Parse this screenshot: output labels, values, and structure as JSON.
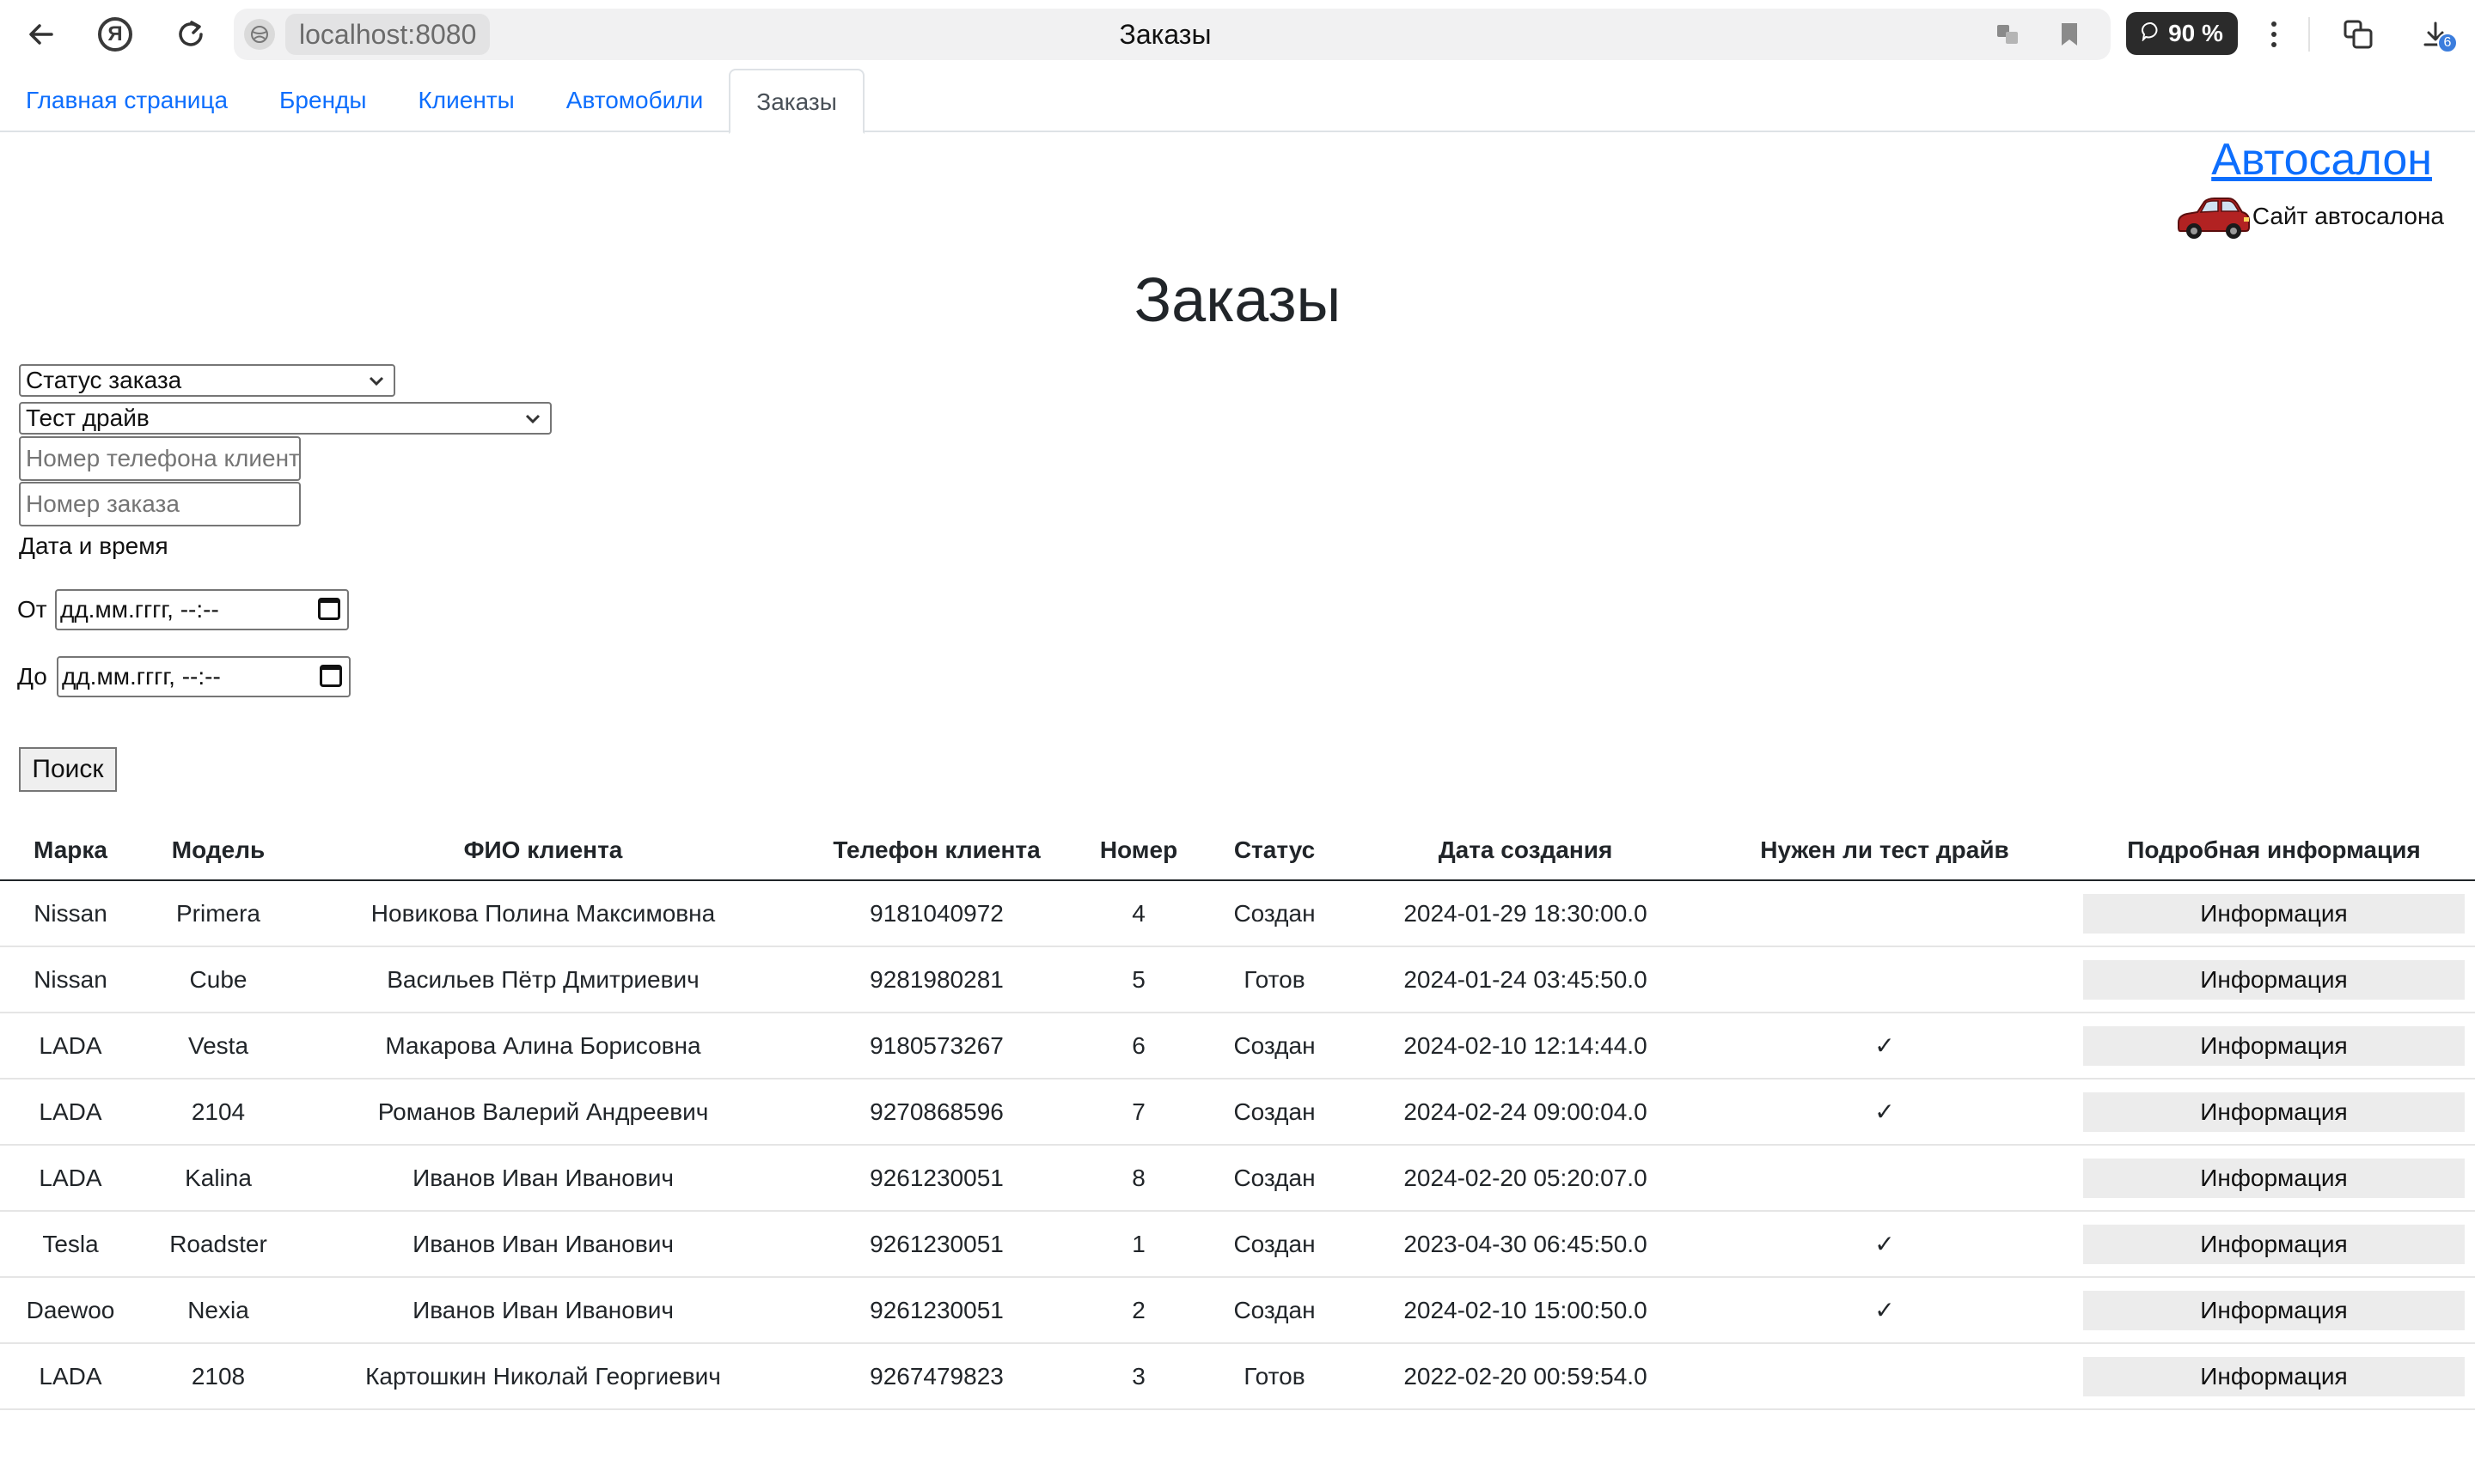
{
  "browser": {
    "url": "localhost:8080",
    "tab_title": "Заказы",
    "zoom": "90 %",
    "downloads_count": "6",
    "icons": [
      "back-arrow-icon",
      "yandex-logo-icon",
      "reload-icon",
      "site-info-icon",
      "translate-icon",
      "bookmark-icon",
      "comment-bubble-icon",
      "more-vertical-icon",
      "tab-collections-icon",
      "download-icon"
    ]
  },
  "nav": {
    "tabs": [
      {
        "label": "Главная страница",
        "active": false
      },
      {
        "label": "Бренды",
        "active": false
      },
      {
        "label": "Клиенты",
        "active": false
      },
      {
        "label": "Автомобили",
        "active": false
      },
      {
        "label": "Заказы",
        "active": true
      }
    ]
  },
  "brand": {
    "title": "Автосалон",
    "subtitle": "Сайт автосалона",
    "car_color": "#b22222"
  },
  "page": {
    "heading": "Заказы"
  },
  "filters": {
    "status_select": "Статус заказа",
    "test_drive_select": "Тест драйв",
    "phone_placeholder": "Номер телефона клиента",
    "order_number_placeholder": "Номер заказа",
    "datetime_label": "Дата и время",
    "from_label": "От",
    "from_value": "дд.мм.гггг, --:--",
    "to_label": "До",
    "to_value": "дд.мм.гггг, --:--",
    "search_button": "Поиск"
  },
  "table": {
    "headers": [
      "Марка",
      "Модель",
      "ФИО клиента",
      "Телефон клиента",
      "Номер",
      "Статус",
      "Дата создания",
      "Нужен ли тест драйв",
      "Подробная информация"
    ],
    "info_button": "Информация",
    "check_mark": "✓",
    "rows": [
      {
        "brand": "Nissan",
        "model": "Primera",
        "client": "Новикова Полина Максимовна",
        "phone": "9181040972",
        "number": "4",
        "status": "Создан",
        "created": "2024-01-29 18:30:00.0",
        "test_drive": ""
      },
      {
        "brand": "Nissan",
        "model": "Cube",
        "client": "Васильев Пётр Дмитриевич",
        "phone": "9281980281",
        "number": "5",
        "status": "Готов",
        "created": "2024-01-24 03:45:50.0",
        "test_drive": ""
      },
      {
        "brand": "LADA",
        "model": "Vesta",
        "client": "Макарова Алина Борисовна",
        "phone": "9180573267",
        "number": "6",
        "status": "Создан",
        "created": "2024-02-10 12:14:44.0",
        "test_drive": "✓"
      },
      {
        "brand": "LADA",
        "model": "2104",
        "client": "Романов Валерий Андреевич",
        "phone": "9270868596",
        "number": "7",
        "status": "Создан",
        "created": "2024-02-24 09:00:04.0",
        "test_drive": "✓"
      },
      {
        "brand": "LADA",
        "model": "Kalina",
        "client": "Иванов Иван Иванович",
        "phone": "9261230051",
        "number": "8",
        "status": "Создан",
        "created": "2024-02-20 05:20:07.0",
        "test_drive": ""
      },
      {
        "brand": "Tesla",
        "model": "Roadster",
        "client": "Иванов Иван Иванович",
        "phone": "9261230051",
        "number": "1",
        "status": "Создан",
        "created": "2023-04-30 06:45:50.0",
        "test_drive": "✓"
      },
      {
        "brand": "Daewoo",
        "model": "Nexia",
        "client": "Иванов Иван Иванович",
        "phone": "9261230051",
        "number": "2",
        "status": "Создан",
        "created": "2024-02-10 15:00:50.0",
        "test_drive": "✓"
      },
      {
        "brand": "LADA",
        "model": "2108",
        "client": "Картошкин Николай Георгиевич",
        "phone": "9267479823",
        "number": "3",
        "status": "Готов",
        "created": "2022-02-20 00:59:54.0",
        "test_drive": ""
      }
    ]
  }
}
